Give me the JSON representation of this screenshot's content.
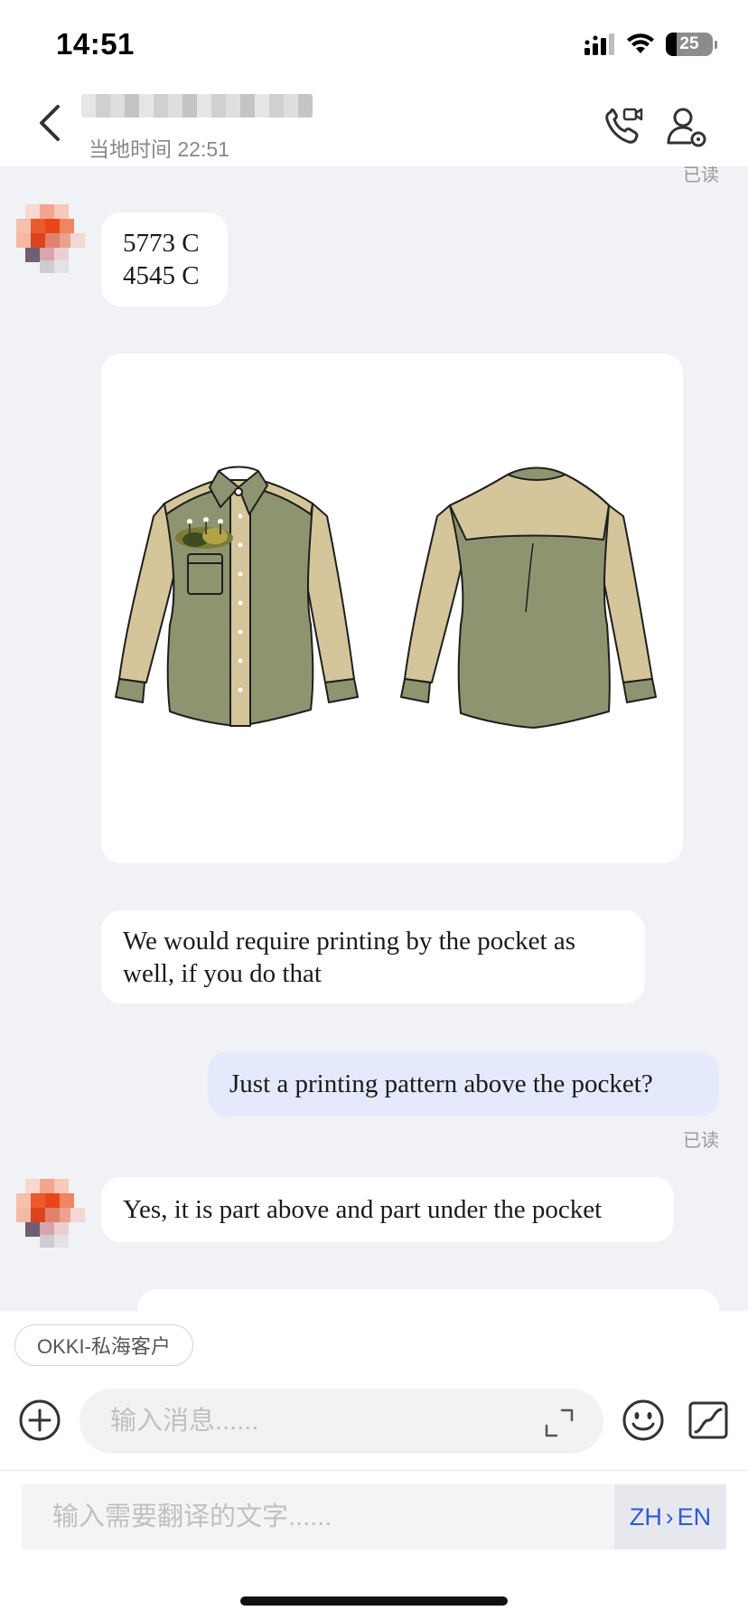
{
  "status": {
    "time": "14:51",
    "battery": "25",
    "icons": [
      "signal-icon",
      "wifi-icon",
      "battery-icon"
    ]
  },
  "header": {
    "back_icon": "chevron-left-icon",
    "local_time": "当地时间 22:51",
    "call_icon": "video-call-icon",
    "profile_icon": "contact-settings-icon"
  },
  "messages": {
    "read_top": "已读",
    "m1_line1": "5773 C",
    "m1_line2": "4545 C",
    "m3_text": "We would require printing by the pocket as well, if you do that",
    "m4_text": "Just a printing pattern above the pocket?",
    "m4_status": "已读",
    "m5_text": "Yes, it is part above and part under the pocket"
  },
  "image": {
    "description_icon": "shirt-front-back-image"
  },
  "composer": {
    "tag": "OKKI-私海客户",
    "input_placeholder": "输入消息......",
    "translate_placeholder": "输入需要翻译的文字......",
    "lang_from": "ZH",
    "lang_arrow": "›",
    "lang_to": "EN"
  },
  "colors": {
    "accent": "#2b5bd6",
    "my_bubble": "#e5e9fc",
    "chat_bg": "#f1f2f6",
    "shirt_body": "#8f9470",
    "shirt_sleeve": "#d4c69a"
  }
}
